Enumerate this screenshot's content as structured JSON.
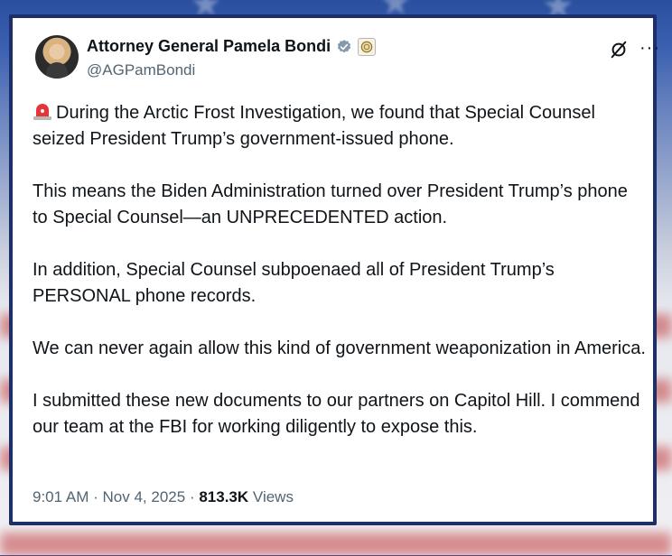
{
  "post": {
    "author": {
      "display_name": "Attorney General Pamela Bondi",
      "handle": "@AGPamBondi"
    },
    "paragraphs": [
      "During the Arctic Frost Investigation, we found that Special Counsel seized President Trump’s government-issued phone.",
      "This means the Biden Administration turned over President Trump’s phone to Special Counsel—an UNPRECEDENTED action.",
      "In addition, Special Counsel subpoenaed all of President Trump’s PERSONAL phone records.",
      "We can never again allow this kind of government weaponization in America.",
      "I submitted these new documents to our partners on Capitol Hill. I commend our team at the FBI for working diligently to expose this."
    ],
    "meta": {
      "time": "9:01 AM",
      "date": "Nov 4, 2025",
      "views_count": "813.3K",
      "views_label": "Views",
      "separator": "·"
    },
    "icons": {
      "verified": "verified-badge-icon",
      "affiliation": "government-seal-icon",
      "lead_emoji": "police-siren-icon",
      "grok": "grok-icon",
      "more": "more-options-icon"
    },
    "colors": {
      "text": "#0f1419",
      "muted": "#536471",
      "frame": "#1d2f6b",
      "verified": "#829aab"
    }
  }
}
